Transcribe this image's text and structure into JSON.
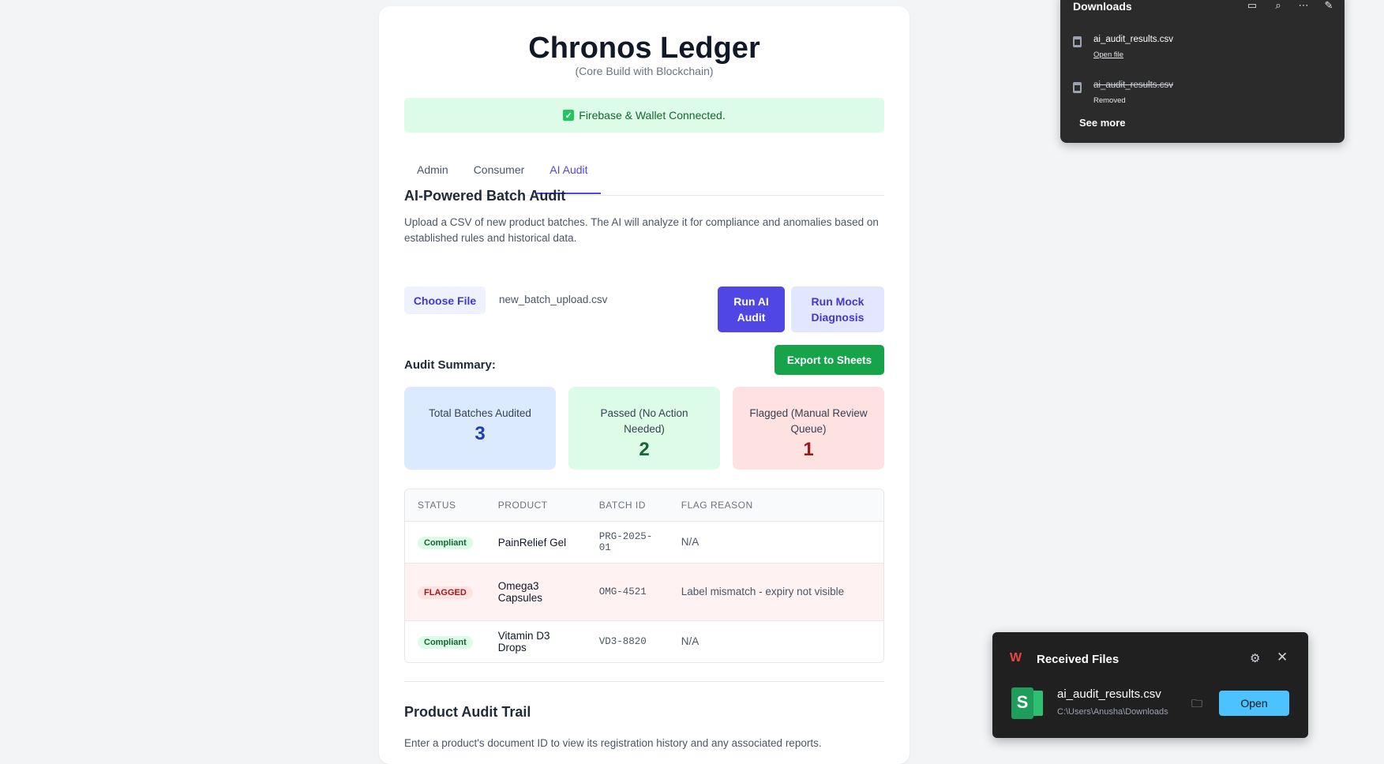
{
  "app": {
    "title": "Chronos Ledger",
    "subtitle": "(Core Build with Blockchain)",
    "status_message": "Firebase & Wallet Connected."
  },
  "tabs": [
    {
      "label": "Admin",
      "active": false
    },
    {
      "label": "Consumer",
      "active": false
    },
    {
      "label": "AI Audit",
      "active": true
    }
  ],
  "audit": {
    "heading": "AI-Powered Batch Audit",
    "description": "Upload a CSV of new product batches. The AI will analyze it for compliance and anomalies based on established rules and historical data.",
    "choose_file_label": "Choose File",
    "selected_file": "new_batch_upload.csv",
    "run_ai_label": "Run AI Audit",
    "run_mock_label": "Run Mock Diagnosis",
    "summary_label": "Audit Summary:",
    "export_label": "Export to Sheets",
    "stats": [
      {
        "label": "Total Batches Audited",
        "value": "3"
      },
      {
        "label": "Passed (No Action Needed)",
        "value": "2"
      },
      {
        "label": "Flagged (Manual Review Queue)",
        "value": "1"
      }
    ],
    "table": {
      "headers": [
        "STATUS",
        "PRODUCT",
        "BATCH ID",
        "FLAG REASON"
      ],
      "rows": [
        {
          "status": "Compliant",
          "product": "PainRelief Gel",
          "batch_id": "PRG-2025-01",
          "reason": "N/A"
        },
        {
          "status": "FLAGGED",
          "product": "Omega3 Capsules",
          "batch_id": "OMG-4521",
          "reason": "Label mismatch - expiry not visible"
        },
        {
          "status": "Compliant",
          "product": "Vitamin D3 Drops",
          "batch_id": "VD3-8820",
          "reason": "N/A"
        }
      ]
    }
  },
  "trail": {
    "heading": "Product Audit Trail",
    "description": "Enter a product's document ID to view its registration history and any associated reports."
  },
  "downloads": {
    "title": "Downloads",
    "items": [
      {
        "name": "ai_audit_results.csv",
        "sub": "Open file"
      },
      {
        "name": "ai_audit_results.csv",
        "sub": "Removed"
      }
    ],
    "see_more": "See more"
  },
  "toast": {
    "title": "Received Files",
    "file": "ai_audit_results.csv",
    "path": "C:\\Users\\Anusha\\Downloads",
    "open_label": "Open"
  },
  "colors": {
    "accent": "#4f46e5",
    "success": "#16a34a",
    "danger": "#991b1b"
  }
}
